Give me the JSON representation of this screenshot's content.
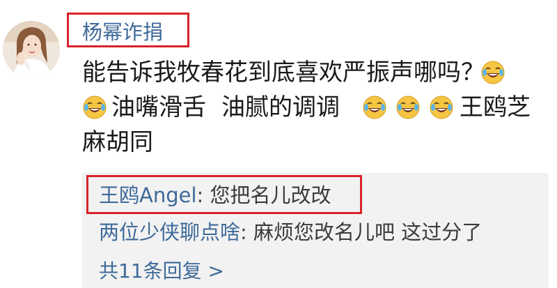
{
  "comment": {
    "username": "杨幂诈捐",
    "line1": "能告诉我牧春花到底喜欢严振声哪吗？",
    "line2_a": "油嘴滑舌",
    "line2_b": "油腻的调调",
    "line2_c": "王鸥芝",
    "line3": "麻胡同",
    "emoji_name": "laughing-crying-icon"
  },
  "replies": [
    {
      "author": "王鸥Angel",
      "separator": ":",
      "text": "您把名儿改改"
    },
    {
      "author": "两位少侠聊点啥",
      "separator": ":",
      "text": "麻烦您改名儿吧  这过分了"
    }
  ],
  "more_replies_label": "共11条回复 >",
  "colors": {
    "highlight": "#d9232a",
    "link": "#3e6a99",
    "reply_background": "#f2f2f2"
  }
}
